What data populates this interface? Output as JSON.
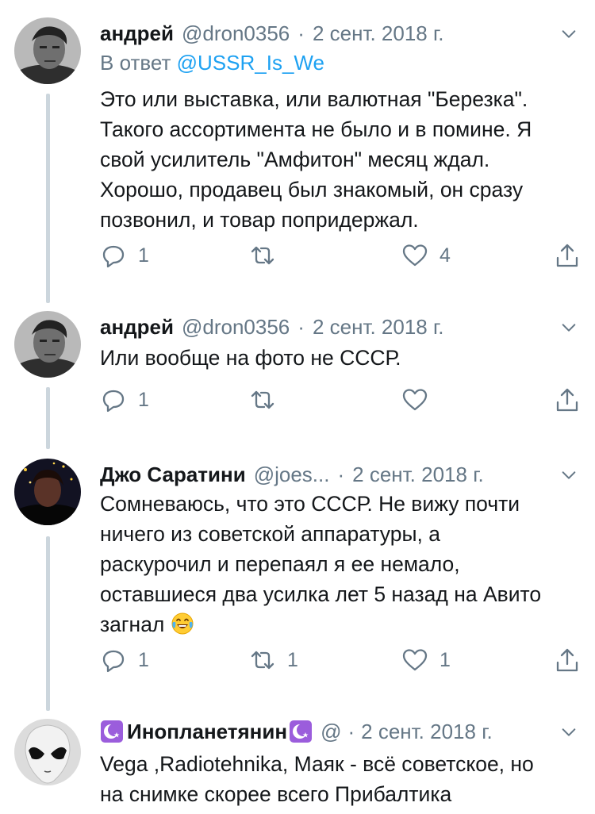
{
  "tweets": [
    {
      "name": "андрей",
      "handle": "@dron0356",
      "dot": "·",
      "time": "2 сент. 2018 г.",
      "reply_prefix": "В ответ ",
      "reply_to": "@USSR_Is_We",
      "text_lines": [
        "Это или выставка, или валютная \"Березка\".",
        "Такого ассортимента не было и в помине. Я",
        "свой усилитель \"Амфитон\" месяц ждал.",
        "Хорошо, продавец был знакомый, он сразу",
        "позвонил, и товар попридержал."
      ],
      "reply_count": "1",
      "retweet_count": "",
      "like_count": "4"
    },
    {
      "name": "андрей",
      "handle": "@dron0356",
      "dot": "·",
      "time": "2 сент. 2018 г.",
      "text_lines": [
        "Или вообще на фото не СССР."
      ],
      "reply_count": "1",
      "retweet_count": "",
      "like_count": ""
    },
    {
      "name": "Джо Саратини",
      "handle": "@joes...",
      "dot": "·",
      "time": "2 сент. 2018 г.",
      "text_lines": [
        "Сомневаюсь, что это СССР. Не вижу почти",
        "ничего из советской аппаратуры, а",
        "раскурочил и перепаял я ее немало,",
        "оставшиеся два усилка лет 5 назад на Авито",
        "загнал"
      ],
      "emoji": "face-with-tears-of-joy",
      "reply_count": "1",
      "retweet_count": "1",
      "like_count": "1"
    },
    {
      "name": "Инопланетянин",
      "handle": "@",
      "dot": "·",
      "time": "2 сент. 2018 г.",
      "text_lines": [
        "Vega ,Radiotehnika, Маяк - всё советское, но",
        "на снимке скорее всего Прибалтика"
      ]
    }
  ],
  "colors": {
    "link": "#1da1f2",
    "muted": "#657786",
    "thread_line": "#ccd6dd",
    "name_badge": "#9b5ddc"
  }
}
